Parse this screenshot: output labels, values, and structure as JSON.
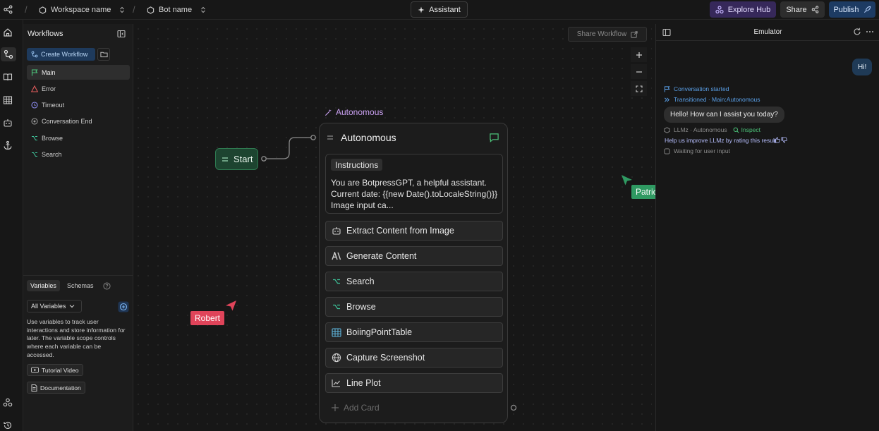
{
  "topbar": {
    "workspace_name": "Workspace name",
    "bot_name": "Bot name",
    "assistant_label": "Assistant",
    "explore_hub_label": "Explore Hub",
    "share_label": "Share",
    "publish_label": "Publish"
  },
  "workflows": {
    "title": "Workflows",
    "create_label": "Create Workflow",
    "items": [
      {
        "label": "Main",
        "icon": "flag-icon",
        "selected": true
      },
      {
        "label": "Error",
        "icon": "warning-triangle-icon"
      },
      {
        "label": "Timeout",
        "icon": "clock-icon"
      },
      {
        "label": "Conversation End",
        "icon": "circle-dot-icon"
      },
      {
        "label": "Browse",
        "icon": "branch-icon"
      },
      {
        "label": "Search",
        "icon": "branch-icon"
      }
    ]
  },
  "variables": {
    "tabs": [
      "Variables",
      "Schemas"
    ],
    "filter_label": "All Variables",
    "description": "Use variables to track user interactions and store information for later. The variable scope controls where each variable can be accessed.",
    "tutorial_label": "Tutorial Video",
    "documentation_label": "Documentation"
  },
  "canvas": {
    "share_workflow_label": "Share Workflow",
    "start_label": "Start",
    "node_caption": "Autonomous",
    "node_title": "Autonomous",
    "instructions_label": "Instructions",
    "instructions_text": "You are BotpressGPT, a helpful assistant.\nCurrent date: {{new Date().toLocaleString()}} Image input ca...",
    "cards": [
      {
        "label": "Extract Content from Image",
        "icon": "robot-icon"
      },
      {
        "label": "Generate Content",
        "icon": "ai-letters-icon"
      },
      {
        "label": "Search",
        "icon": "branch-icon"
      },
      {
        "label": "Browse",
        "icon": "branch-icon"
      },
      {
        "label": "BoiingPointTable",
        "icon": "table-icon"
      },
      {
        "label": "Capture Screenshot",
        "icon": "globe-icon"
      },
      {
        "label": "Line Plot",
        "icon": "line-chart-icon"
      }
    ],
    "add_card_label": "Add Card",
    "cursors": [
      {
        "name": "Patrick",
        "color": "#2f9a62"
      },
      {
        "name": "Robert",
        "color": "#e0445a"
      }
    ]
  },
  "emulator": {
    "title": "Emulator",
    "user_message": "Hi!",
    "event_started": "Conversation started",
    "event_transitioned": "Transitioned · Main:Autonomous",
    "bot_message": "Hello! How can I assist you today?",
    "meta_source": "LLMz · Autonomous",
    "inspect_label": "Inspect",
    "improve_text": "Help us improve LLMz by rating this result",
    "waiting_text": "Waiting for user input"
  }
}
